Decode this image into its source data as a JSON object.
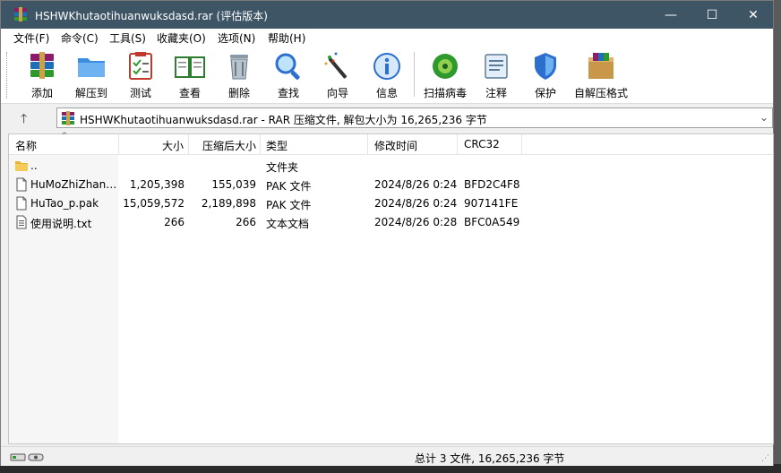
{
  "window": {
    "title": "HSHWKhutaotihuanwuksdasd.rar (评估版本)",
    "min_glyph": "—",
    "max_glyph": "☐",
    "close_glyph": "✕"
  },
  "menu": [
    "文件(F)",
    "命令(C)",
    "工具(S)",
    "收藏夹(O)",
    "选项(N)",
    "帮助(H)"
  ],
  "toolbar": {
    "items": [
      {
        "label": "添加",
        "icon": "add-archive-icon"
      },
      {
        "label": "解压到",
        "icon": "extract-folder-icon"
      },
      {
        "label": "测试",
        "icon": "test-checklist-icon"
      },
      {
        "label": "查看",
        "icon": "view-book-icon"
      },
      {
        "label": "删除",
        "icon": "trash-icon"
      },
      {
        "label": "查找",
        "icon": "magnifier-icon"
      },
      {
        "label": "向导",
        "icon": "wizard-wand-icon"
      },
      {
        "label": "信息",
        "icon": "info-icon"
      },
      {
        "label": "扫描病毒",
        "icon": "virus-scan-icon"
      },
      {
        "label": "注释",
        "icon": "comment-icon"
      },
      {
        "label": "保护",
        "icon": "shield-icon"
      },
      {
        "label": "自解压格式",
        "icon": "sfx-box-icon"
      }
    ]
  },
  "address": {
    "text": "HSHWKhutaotihuanwuksdasd.rar - RAR 压缩文件, 解包大小为 16,265,236 字节",
    "up_glyph": "🡑",
    "drop_glyph": "⌄"
  },
  "columns": {
    "name": "名称",
    "size": "大小",
    "packed": "压缩后大小",
    "type": "类型",
    "modified": "修改时间",
    "crc": "CRC32",
    "sort_glyph": "^"
  },
  "files": [
    {
      "name": "..",
      "size": "",
      "packed": "",
      "type": "文件夹",
      "modified": "",
      "crc": "",
      "icon": "folder-icon"
    },
    {
      "name": "HuMoZhiZhan…",
      "size": "1,205,398",
      "packed": "155,039",
      "type": "PAK 文件",
      "modified": "2024/8/26 0:24",
      "crc": "BFD2C4F8",
      "icon": "file-icon"
    },
    {
      "name": "HuTao_p.pak",
      "size": "15,059,572",
      "packed": "2,189,898",
      "type": "PAK 文件",
      "modified": "2024/8/26 0:24",
      "crc": "907141FE",
      "icon": "file-icon"
    },
    {
      "name": "使用说明.txt",
      "size": "266",
      "packed": "266",
      "type": "文本文档",
      "modified": "2024/8/26 0:28",
      "crc": "BFC0A549",
      "icon": "text-file-icon"
    }
  ],
  "status": {
    "text": "总计 3 文件, 16,265,236 字节",
    "grip_glyph": "⋰"
  },
  "colors": {
    "titlebar": "#3e5566",
    "accent_green": "#2e9a2e",
    "accent_blue": "#2d6fcf"
  }
}
